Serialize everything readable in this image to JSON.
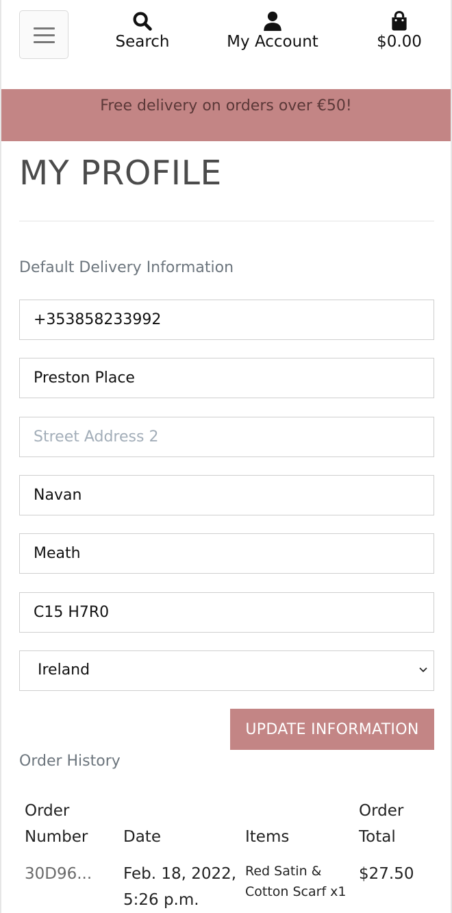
{
  "nav": {
    "menu_icon": "hamburger-icon",
    "search": {
      "label": "Search",
      "icon": "search-icon"
    },
    "account": {
      "label": "My Account",
      "icon": "user-icon"
    },
    "bag": {
      "label": "$0.00",
      "icon": "shopping-bag-icon"
    }
  },
  "banner": {
    "text": "Free delivery on orders over €50!",
    "color": "#c38585"
  },
  "profile": {
    "title": "MY PROFILE",
    "delivery_label": "Default Delivery Information",
    "fields": {
      "phone": "+353858233992",
      "street1": "Preston Place",
      "street2_placeholder": "Street Address 2",
      "town": "Navan",
      "county": "Meath",
      "postcode": "C15 H7R0"
    },
    "country": "Ireland",
    "update_label": "UPDATE INFORMATION"
  },
  "orders": {
    "label": "Order History",
    "headers": {
      "number": "Order Number",
      "date": "Date",
      "items": "Items",
      "total": "Order Total"
    },
    "rows": [
      {
        "number": "30D96...",
        "date": "Feb. 18, 2022, 5:26 p.m.",
        "items": "Red Satin & Cotton Scarf x1",
        "total": "$27.50"
      }
    ]
  },
  "colors": {
    "accent": "#c38585",
    "muted_text": "#6c757d"
  }
}
